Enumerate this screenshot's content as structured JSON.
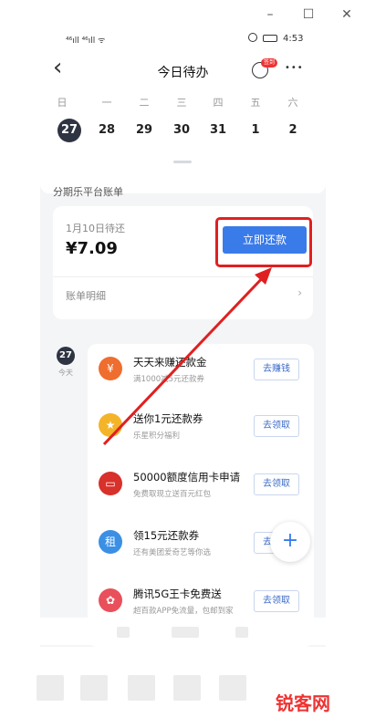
{
  "window": {
    "minimize": "–",
    "maximize": "☐",
    "close": "✕"
  },
  "status_bar": {
    "left": "⁴⁶ıll ⁴⁶ıll ᯤ",
    "time": "4:53"
  },
  "header": {
    "title": "今日待办",
    "back": "‹",
    "more": "•••",
    "badge": "签到"
  },
  "calendar": {
    "weekdays": [
      "日",
      "一",
      "二",
      "三",
      "四",
      "五",
      "六"
    ],
    "dates": [
      "27",
      "28",
      "29",
      "30",
      "31",
      "1",
      "2"
    ]
  },
  "section_title": "分期乐平台账单",
  "bill": {
    "due_label": "1月10日待还",
    "amount": "¥7.09",
    "pay_button": "立即还款",
    "detail_label": "账单明细",
    "chevron": "›"
  },
  "day": {
    "number": "27",
    "label": "今天"
  },
  "tasks": [
    {
      "title": "天天来赚还款金",
      "subtitle": "满1000减5元还款券",
      "button": "去赚钱",
      "icon": "coin-icon",
      "color": "#ef6d2e",
      "glyph": "¥"
    },
    {
      "title": "送你1元还款券",
      "subtitle": "乐星积分福利",
      "button": "去领取",
      "icon": "star-icon",
      "color": "#f4b42a",
      "glyph": "★"
    },
    {
      "title": "50000额度信用卡申请",
      "subtitle": "免费取现立送百元红包",
      "button": "去领取",
      "icon": "card-icon",
      "color": "#d8302a",
      "glyph": "▭"
    },
    {
      "title": "领15元还款券",
      "subtitle": "还有美团爱奇艺等你选",
      "button": "去领取",
      "icon": "coupon-icon",
      "color": "#3b8fe4",
      "glyph": "租"
    },
    {
      "title": "腾讯5G王卡免费送",
      "subtitle": "超百款APP免流量，包邮到家",
      "button": "去领取",
      "icon": "sim-icon",
      "color": "#e8505b",
      "glyph": "✿"
    }
  ],
  "fab": "+",
  "watermark": "锐客网"
}
